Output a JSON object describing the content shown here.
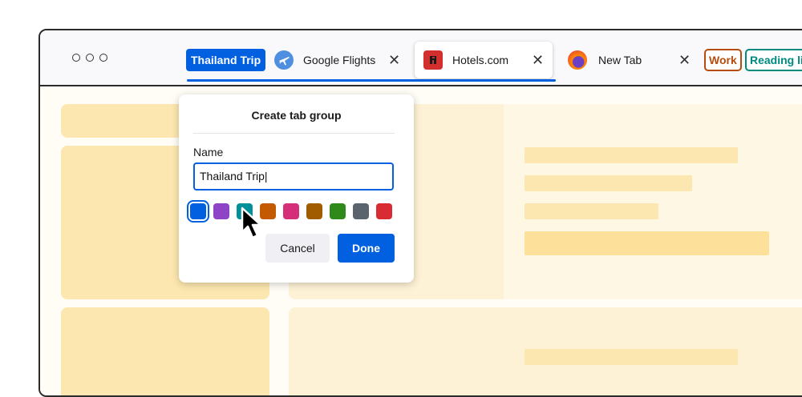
{
  "tabs": {
    "group_label": "Thailand Trip",
    "items": [
      {
        "label": "Google Flights",
        "icon": "google-flights-icon"
      },
      {
        "label": "Hotels.com",
        "icon": "hotels-com-icon"
      },
      {
        "label": "New Tab",
        "icon": "firefox-icon"
      }
    ],
    "close_symbol": "✕",
    "other_groups": [
      {
        "label": "Work",
        "color": "#b84c0e"
      },
      {
        "label": "Reading lis",
        "color": "#008a80"
      }
    ]
  },
  "popup": {
    "title": "Create tab group",
    "name_label": "Name",
    "name_value": "Thailand Trip|",
    "colors": [
      "#0060df",
      "#8e44c6",
      "#00909a",
      "#c45a00",
      "#d62f7a",
      "#a15c00",
      "#2f8a1a",
      "#5b636d",
      "#d92b34"
    ],
    "selected_color_index": 0,
    "cancel_label": "Cancel",
    "done_label": "Done"
  },
  "theme": {
    "accent": "#0060df"
  }
}
